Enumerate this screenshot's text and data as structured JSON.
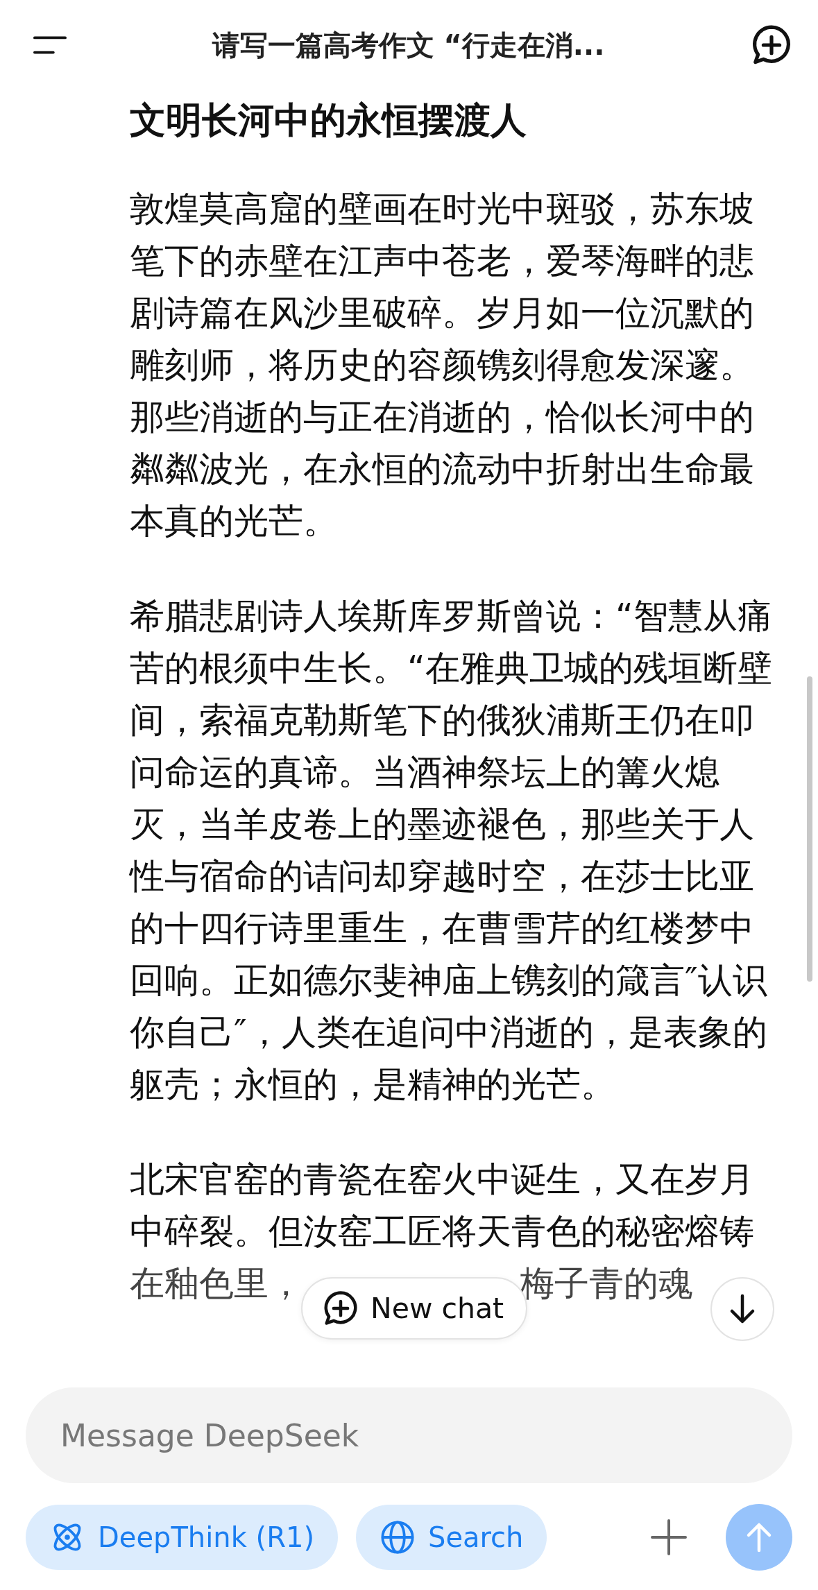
{
  "header": {
    "title": "请写一篇高考作文 “行走在消..."
  },
  "article": {
    "title": "文明长河中的永恒摆渡人",
    "paragraphs": [
      "敦煌莫高窟的壁画在时光中斑驳，苏东坡笔下的赤壁在江声中苍老，爱琴海畔的悲剧诗篇在风沙里破碎。岁月如一位沉默的雕刻师，将历史的容颜镌刻得愈发深邃。那些消逝的与正在消逝的，恰似长河中的粼粼波光，在永恒的流动中折射出生命最本真的光芒。",
      "希腊悲剧诗人埃斯库罗斯曾说：“智慧从痛苦的根须中生长。“在雅典卫城的残垣断壁间，索福克勒斯笔下的俄狄浦斯王仍在叩问命运的真谛。当酒神祭坛上的篝火熄灭，当羊皮卷上的墨迹褪色，那些关于人性与宿命的诘问却穿越时空，在莎士比亚的十四行诗里重生，在曹雪芹的红楼梦中回响。正如德尔斐神庙上镌刻的箴言″认识你自己″，人类在追问中消逝的，是表象的躯壳；永恒的，是精神的光芒。"
    ],
    "partial_paragraph": {
      "text": "北宋官窑的青瓷在窑火中诞生，又在岁月中碎裂。但汝窑工匠将天青色的秘密熔铸",
      "last_line_start": "在釉色里，",
      "last_line_end": "梅子青的魂"
    }
  },
  "floating": {
    "new_chat": "New chat"
  },
  "composer": {
    "placeholder": "Message DeepSeek",
    "send_disabled": true,
    "options": [
      {
        "label": "DeepThink (R1)",
        "kind": "deepthink",
        "selected": true
      },
      {
        "label": "Search",
        "kind": "search",
        "selected": true
      }
    ]
  }
}
